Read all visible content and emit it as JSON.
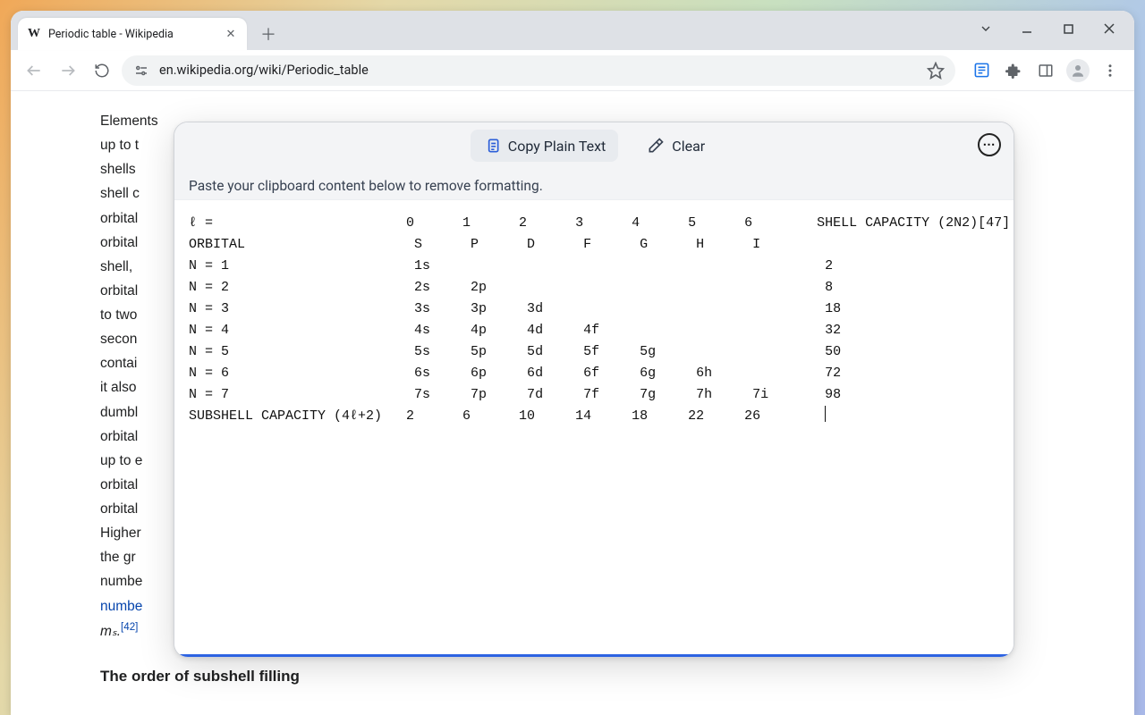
{
  "browser": {
    "tab_title": "Periodic table - Wikipedia",
    "url": "en.wikipedia.org/wiki/Periodic_table"
  },
  "article": {
    "lines": [
      "Elements",
      "up to t",
      "shells",
      "shell c",
      "orbital",
      "orbital",
      "shell,",
      "orbital",
      "to two",
      "secon",
      "contai",
      "it also",
      "dumbl",
      "orbital",
      "up to e",
      "orbital",
      "orbital",
      "Higher",
      "the gr",
      "numbe"
    ],
    "link_line": "numbe",
    "ms_html": "mₛ.",
    "ms_ref": "[42]",
    "heading": "The order of subshell filling"
  },
  "panel": {
    "copy_label": "Copy Plain Text",
    "clear_label": "Clear",
    "subtitle": "Paste your clipboard content below to remove formatting."
  },
  "chart_data": {
    "type": "table",
    "title": "Electron subshell capacities",
    "l_values": [
      0,
      1,
      2,
      3,
      4,
      5,
      6
    ],
    "orbital_letters": [
      "S",
      "P",
      "D",
      "F",
      "G",
      "H",
      "I"
    ],
    "shell_capacity_header": "SHELL CAPACITY (2N2)[47]",
    "rows": [
      {
        "n": 1,
        "subshells": [
          "1s"
        ],
        "capacity": 2
      },
      {
        "n": 2,
        "subshells": [
          "2s",
          "2p"
        ],
        "capacity": 8
      },
      {
        "n": 3,
        "subshells": [
          "3s",
          "3p",
          "3d"
        ],
        "capacity": 18
      },
      {
        "n": 4,
        "subshells": [
          "4s",
          "4p",
          "4d",
          "4f"
        ],
        "capacity": 32
      },
      {
        "n": 5,
        "subshells": [
          "5s",
          "5p",
          "5d",
          "5f",
          "5g"
        ],
        "capacity": 50
      },
      {
        "n": 6,
        "subshells": [
          "6s",
          "6p",
          "6d",
          "6f",
          "6g",
          "6h"
        ],
        "capacity": 72
      },
      {
        "n": 7,
        "subshells": [
          "7s",
          "7p",
          "7d",
          "7f",
          "7g",
          "7h",
          "7i"
        ],
        "capacity": 98
      }
    ],
    "subshell_capacity_label": "SUBSHELL CAPACITY (4ℓ+2)",
    "subshell_capacity": [
      2,
      6,
      10,
      14,
      18,
      22,
      26
    ]
  }
}
